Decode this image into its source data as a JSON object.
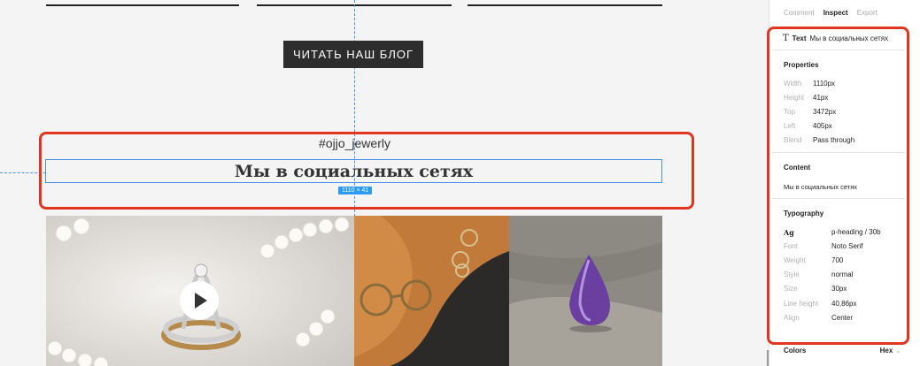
{
  "canvas": {
    "blog_button": "ЧИТАТЬ НАШ БЛОГ",
    "hashtag": "#ojjo_jewerly",
    "heading": "Мы в социальных сетях",
    "size_badge": "1110 × 41"
  },
  "panel": {
    "tabs": [
      "Comment",
      "Inspect",
      "Export"
    ],
    "active_tab": "Inspect",
    "layer": {
      "type": "Text",
      "name": "Мы в социальных сетях"
    },
    "properties": {
      "title": "Properties",
      "rows": [
        {
          "key": "Width",
          "value": "1110px"
        },
        {
          "key": "Height",
          "value": "41px"
        },
        {
          "key": "Top",
          "value": "3472px"
        },
        {
          "key": "Left",
          "value": "405px"
        },
        {
          "key": "Blend",
          "value": "Pass through"
        }
      ]
    },
    "content": {
      "title": "Content",
      "text": "Мы в социальных сетях"
    },
    "typography": {
      "title": "Typography",
      "rows": [
        {
          "key": "Ag",
          "value": "p-heading / 30b"
        },
        {
          "key": "Font",
          "value": "Noto Serif"
        },
        {
          "key": "Weight",
          "value": "700"
        },
        {
          "key": "Style",
          "value": "normal"
        },
        {
          "key": "Size",
          "value": "30px"
        },
        {
          "key": "Line height",
          "value": "40,86px"
        },
        {
          "key": "Align",
          "value": "Center"
        }
      ]
    },
    "colors": {
      "label": "Colors",
      "format": "Hex"
    }
  },
  "accent": {
    "selection": "#4a90e2",
    "highlight": "#e2351f",
    "badge": "#2b9af3"
  }
}
